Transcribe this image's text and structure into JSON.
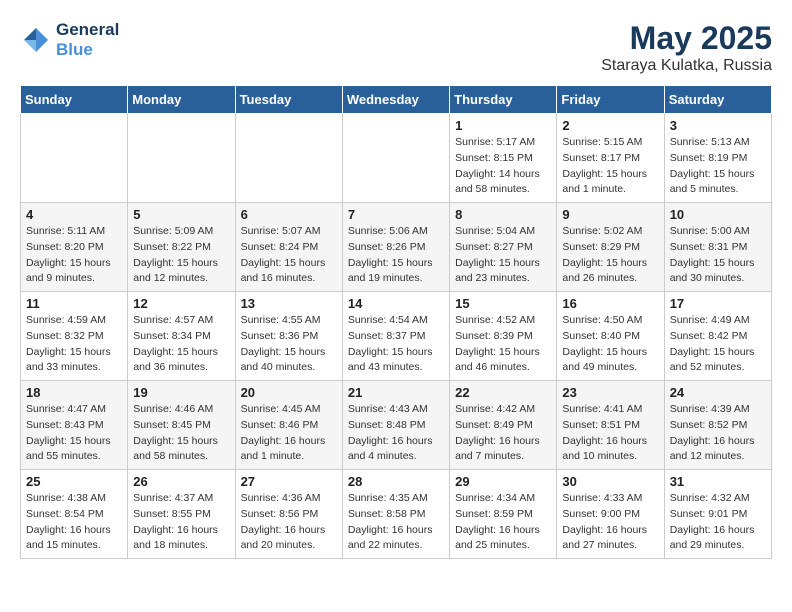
{
  "header": {
    "logo_line1": "General",
    "logo_line2": "Blue",
    "month": "May 2025",
    "location": "Staraya Kulatka, Russia"
  },
  "weekdays": [
    "Sunday",
    "Monday",
    "Tuesday",
    "Wednesday",
    "Thursday",
    "Friday",
    "Saturday"
  ],
  "weeks": [
    [
      {
        "day": "",
        "info": ""
      },
      {
        "day": "",
        "info": ""
      },
      {
        "day": "",
        "info": ""
      },
      {
        "day": "",
        "info": ""
      },
      {
        "day": "1",
        "info": "Sunrise: 5:17 AM\nSunset: 8:15 PM\nDaylight: 14 hours\nand 58 minutes."
      },
      {
        "day": "2",
        "info": "Sunrise: 5:15 AM\nSunset: 8:17 PM\nDaylight: 15 hours\nand 1 minute."
      },
      {
        "day": "3",
        "info": "Sunrise: 5:13 AM\nSunset: 8:19 PM\nDaylight: 15 hours\nand 5 minutes."
      }
    ],
    [
      {
        "day": "4",
        "info": "Sunrise: 5:11 AM\nSunset: 8:20 PM\nDaylight: 15 hours\nand 9 minutes."
      },
      {
        "day": "5",
        "info": "Sunrise: 5:09 AM\nSunset: 8:22 PM\nDaylight: 15 hours\nand 12 minutes."
      },
      {
        "day": "6",
        "info": "Sunrise: 5:07 AM\nSunset: 8:24 PM\nDaylight: 15 hours\nand 16 minutes."
      },
      {
        "day": "7",
        "info": "Sunrise: 5:06 AM\nSunset: 8:26 PM\nDaylight: 15 hours\nand 19 minutes."
      },
      {
        "day": "8",
        "info": "Sunrise: 5:04 AM\nSunset: 8:27 PM\nDaylight: 15 hours\nand 23 minutes."
      },
      {
        "day": "9",
        "info": "Sunrise: 5:02 AM\nSunset: 8:29 PM\nDaylight: 15 hours\nand 26 minutes."
      },
      {
        "day": "10",
        "info": "Sunrise: 5:00 AM\nSunset: 8:31 PM\nDaylight: 15 hours\nand 30 minutes."
      }
    ],
    [
      {
        "day": "11",
        "info": "Sunrise: 4:59 AM\nSunset: 8:32 PM\nDaylight: 15 hours\nand 33 minutes."
      },
      {
        "day": "12",
        "info": "Sunrise: 4:57 AM\nSunset: 8:34 PM\nDaylight: 15 hours\nand 36 minutes."
      },
      {
        "day": "13",
        "info": "Sunrise: 4:55 AM\nSunset: 8:36 PM\nDaylight: 15 hours\nand 40 minutes."
      },
      {
        "day": "14",
        "info": "Sunrise: 4:54 AM\nSunset: 8:37 PM\nDaylight: 15 hours\nand 43 minutes."
      },
      {
        "day": "15",
        "info": "Sunrise: 4:52 AM\nSunset: 8:39 PM\nDaylight: 15 hours\nand 46 minutes."
      },
      {
        "day": "16",
        "info": "Sunrise: 4:50 AM\nSunset: 8:40 PM\nDaylight: 15 hours\nand 49 minutes."
      },
      {
        "day": "17",
        "info": "Sunrise: 4:49 AM\nSunset: 8:42 PM\nDaylight: 15 hours\nand 52 minutes."
      }
    ],
    [
      {
        "day": "18",
        "info": "Sunrise: 4:47 AM\nSunset: 8:43 PM\nDaylight: 15 hours\nand 55 minutes."
      },
      {
        "day": "19",
        "info": "Sunrise: 4:46 AM\nSunset: 8:45 PM\nDaylight: 15 hours\nand 58 minutes."
      },
      {
        "day": "20",
        "info": "Sunrise: 4:45 AM\nSunset: 8:46 PM\nDaylight: 16 hours\nand 1 minute."
      },
      {
        "day": "21",
        "info": "Sunrise: 4:43 AM\nSunset: 8:48 PM\nDaylight: 16 hours\nand 4 minutes."
      },
      {
        "day": "22",
        "info": "Sunrise: 4:42 AM\nSunset: 8:49 PM\nDaylight: 16 hours\nand 7 minutes."
      },
      {
        "day": "23",
        "info": "Sunrise: 4:41 AM\nSunset: 8:51 PM\nDaylight: 16 hours\nand 10 minutes."
      },
      {
        "day": "24",
        "info": "Sunrise: 4:39 AM\nSunset: 8:52 PM\nDaylight: 16 hours\nand 12 minutes."
      }
    ],
    [
      {
        "day": "25",
        "info": "Sunrise: 4:38 AM\nSunset: 8:54 PM\nDaylight: 16 hours\nand 15 minutes."
      },
      {
        "day": "26",
        "info": "Sunrise: 4:37 AM\nSunset: 8:55 PM\nDaylight: 16 hours\nand 18 minutes."
      },
      {
        "day": "27",
        "info": "Sunrise: 4:36 AM\nSunset: 8:56 PM\nDaylight: 16 hours\nand 20 minutes."
      },
      {
        "day": "28",
        "info": "Sunrise: 4:35 AM\nSunset: 8:58 PM\nDaylight: 16 hours\nand 22 minutes."
      },
      {
        "day": "29",
        "info": "Sunrise: 4:34 AM\nSunset: 8:59 PM\nDaylight: 16 hours\nand 25 minutes."
      },
      {
        "day": "30",
        "info": "Sunrise: 4:33 AM\nSunset: 9:00 PM\nDaylight: 16 hours\nand 27 minutes."
      },
      {
        "day": "31",
        "info": "Sunrise: 4:32 AM\nSunset: 9:01 PM\nDaylight: 16 hours\nand 29 minutes."
      }
    ]
  ]
}
